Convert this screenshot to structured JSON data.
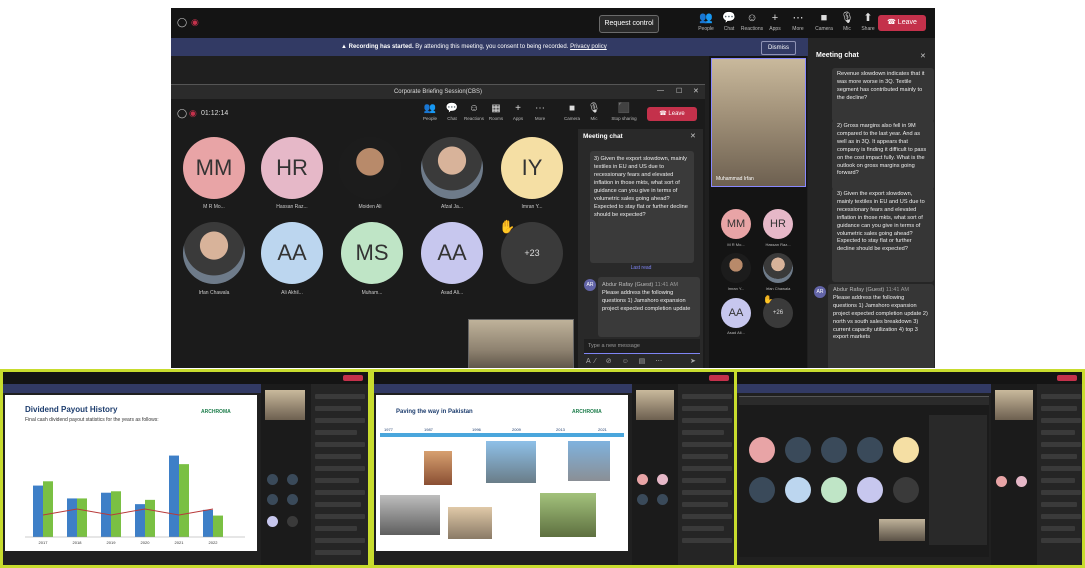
{
  "main": {
    "topbar": {
      "request_control": "Request control",
      "buttons": [
        {
          "icon": "people-icon",
          "label": "People"
        },
        {
          "icon": "chat-icon",
          "label": "Chat"
        },
        {
          "icon": "reactions-icon",
          "label": "Reactions"
        },
        {
          "icon": "apps-icon",
          "label": "Apps"
        },
        {
          "icon": "more-icon",
          "label": "More"
        },
        {
          "icon": "camera-icon",
          "label": "Camera"
        },
        {
          "icon": "mic-icon",
          "label": "Mic"
        },
        {
          "icon": "share-icon",
          "label": "Share"
        }
      ],
      "leave": "Leave"
    },
    "recording_bar": {
      "bold": "Recording has started.",
      "text": "By attending this meeting, you consent to being recorded.",
      "link": "Privacy policy",
      "dismiss": "Dismiss"
    },
    "inner_window": {
      "title": "Corporate Briefing Session(CBS)",
      "timer": "01:12:14",
      "toolbar": [
        {
          "icon": "people-icon",
          "label": "People"
        },
        {
          "icon": "chat-icon",
          "label": "Chat"
        },
        {
          "icon": "reactions-icon",
          "label": "Reactions"
        },
        {
          "icon": "rooms-icon",
          "label": "Rooms"
        },
        {
          "icon": "apps-icon",
          "label": "Apps"
        },
        {
          "icon": "more-icon",
          "label": "More"
        },
        {
          "icon": "camera-icon",
          "label": "Camera"
        },
        {
          "icon": "mic-icon",
          "label": "Mic"
        },
        {
          "icon": "stop-sharing-icon",
          "label": "Stop sharing"
        }
      ],
      "leave": "Leave",
      "participants": [
        {
          "initials": "MM",
          "name": "M R Mo...",
          "color": "#e8a4a6"
        },
        {
          "initials": "HR",
          "name": "Hassan Raz...",
          "color": "#e6b8c8"
        },
        {
          "initials": "",
          "name": "Moiden Ali",
          "color": "#3a4a5a"
        },
        {
          "initials": "",
          "name": "Afzal Ja...",
          "color": "#3a4a5a"
        },
        {
          "initials": "IY",
          "name": "Imran Y...",
          "color": "#f5dfa4"
        },
        {
          "initials": "",
          "name": "Irfan Chawala",
          "color": "#3a4a5a"
        },
        {
          "initials": "AA",
          "name": "Ali Akhil...",
          "color": "#bcd6ef"
        },
        {
          "initials": "MS",
          "name": "Muham...",
          "color": "#bfe5c6"
        },
        {
          "initials": "AA",
          "name": "Asad Ali...",
          "color": "#c7c7ee"
        },
        {
          "initials": "+23",
          "name": "",
          "color": "#3a3a3a"
        }
      ],
      "chat": {
        "title": "Meeting chat",
        "message1": "3) Given the export slowdown, mainly textiles in EU and US due to recessionary fears and elevated inflation in those mkts, what sort of guidance can you give in terms of volumetric sales going ahead? Expected to stay flat or further decline should be expected?",
        "last_read": "Last read",
        "sender": "Abdur Rafay (Guest)",
        "time": "11:41 AM",
        "message2": "Please address the following questions 1) Jamshoro expansion project expected completion update",
        "input_placeholder": "Type a new message"
      }
    },
    "right_column": {
      "video_name": "Muhammad Irfan",
      "participants": [
        {
          "initials": "MM",
          "name": "M R Mo...",
          "color": "#e8a4a6"
        },
        {
          "initials": "HR",
          "name": "Hassan Raz...",
          "color": "#e6b8c8"
        },
        {
          "initials": "",
          "name": "Imran Y...",
          "color": "#3a4a5a"
        },
        {
          "initials": "",
          "name": "Irfan Chawala",
          "color": "#3a4a5a"
        },
        {
          "initials": "AA",
          "name": "Asad Ali...",
          "color": "#c7c7ee"
        },
        {
          "initials": "+26",
          "name": "",
          "color": "#3a3a3a"
        }
      ]
    },
    "chat_panel": {
      "title": "Meeting chat",
      "message1": "Revenue slowdown indicates that it was more worse in 3Q. Textile segment has contributed mainly to the decline?",
      "message2": "2) Gross margins also fell in 9M compared to the last year. And as well as in 3Q. It appears that company is finding it difficult to pass on the cost impact fully. What is the outlook on gross margins going forward?",
      "message3": "3) Given the export slowdown, mainly textiles in EU and US due to recessionary fears and elevated inflation in those mkts, what sort of guidance can you give in terms of volumetric sales going ahead? Expected to stay flat or further decline should be expected?",
      "sender": "Abdur Rafay (Guest)",
      "time": "11:41 AM",
      "message4": "Please address the following questions 1) Jamshoro expansion project expected completion update 2) north vs south sales breakdown 3) current capacity utilization 4) top 3 export markets"
    }
  },
  "slide1": {
    "title": "Dividend Payout History",
    "subtitle": "Final cash dividend payout statistics for the years as follows:",
    "logo": "ARCHROMA",
    "chart_data": {
      "type": "bar",
      "categories": [
        "2017",
        "2018",
        "2019",
        "2020",
        "2021",
        "2022"
      ],
      "series": [
        {
          "name": "Dividend",
          "values": [
            3.6,
            2.7,
            3.1,
            2.3,
            5.7,
            1.9
          ]
        },
        {
          "name": "Payout",
          "values": [
            3.9,
            2.7,
            3.2,
            2.6,
            5.1,
            1.5
          ]
        }
      ],
      "ylim": [
        0,
        7
      ]
    }
  },
  "slide2": {
    "title": "Paving the way in Pakistan",
    "logo": "ARCHROMA",
    "years": [
      "1977",
      "1987",
      "1996",
      "2009",
      "2013",
      "2021"
    ]
  },
  "colors": {
    "teams_purple": "#7f85f5",
    "leave_red": "#c4314b",
    "recording_blue": "#323a64",
    "strip_border": "#c8dc2e"
  }
}
